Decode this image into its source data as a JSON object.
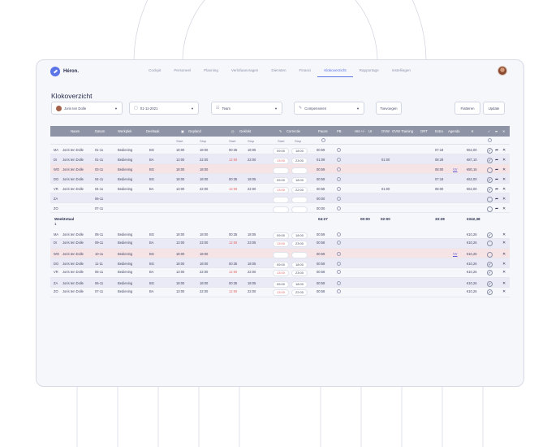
{
  "nav": {
    "brand": "Héron.",
    "items": [
      "Cockpit",
      "Personeel",
      "Planning",
      "Verlofaanvragen",
      "Diensten",
      "Financi",
      "Klokoverzicht",
      "Rapportage",
      "Instellingen"
    ],
    "active_index": 6
  },
  "page": {
    "title": "Klokoverzicht"
  },
  "filters": {
    "employee": "Joris ten Dolle",
    "date": "01-11-2021",
    "team": "Team",
    "completed": "Compenseren"
  },
  "buttons": {
    "add": "Toevoegen",
    "approve": "Fiatteren",
    "update": "Update"
  },
  "columns": {
    "name": "Naam",
    "date": "Datum",
    "workplace": "Werkplek",
    "department": "Deeltaak",
    "planned": "Gepland",
    "clocked": "Geklokt",
    "corrected": "Correctie",
    "break": "Pauze",
    "pb": "PB",
    "hrs": "Hrs +/-",
    "pct": "Ur",
    "ovw": "OVW",
    "ovw_training": "OVW Training",
    "ort": "ORT",
    "extra": "Extra",
    "agenda": "Agenda",
    "euro": "€"
  },
  "subcolumns": {
    "start": "Start",
    "stop": "Stop"
  },
  "week1_rows": [
    {
      "day": "MA",
      "name": "Joris ten Dolle",
      "date": "01-11",
      "workplace": "Bediening",
      "dept": "BG",
      "plan_start": "18:00",
      "plan_stop": "18:00",
      "clk_start": "00:35",
      "clk_stop": "18:05",
      "cor_start": "09:00",
      "cor_stop": "18:00",
      "pause": "00:59",
      "ovw": "",
      "extra": "07:18",
      "agenda": "",
      "euro": "€62,00"
    },
    {
      "day": "DI",
      "name": "Joris ten Dolle",
      "date": "01-11",
      "workplace": "Bediening",
      "dept": "BA",
      "plan_start": "13:00",
      "plan_stop": "22:00",
      "clk_start": "12:59",
      "clk_stop": "22:00",
      "cor_start": "13:00",
      "cor_stop": "23:00",
      "pause": "01:09",
      "ovw": "01:00",
      "extra": "08:28",
      "agenda": "",
      "euro": "€87,10"
    },
    {
      "day": "WO",
      "name": "Joris ten Dolle",
      "date": "03-11",
      "workplace": "Bediening",
      "dept": "BG",
      "plan_start": "18:00",
      "plan_stop": "18:00",
      "clk_start": "",
      "clk_stop": "",
      "cor_start": "",
      "cor_stop": "",
      "pause": "00:59",
      "ovw": "",
      "extra": "08:00",
      "agenda": "VV",
      "euro": "€80,16"
    },
    {
      "day": "DO",
      "name": "Joris ten Dolle",
      "date": "04-11",
      "workplace": "Bediening",
      "dept": "BG",
      "plan_start": "18:00",
      "plan_stop": "18:00",
      "clk_start": "00:35",
      "clk_stop": "18:05",
      "cor_start": "09:00",
      "cor_stop": "18:00",
      "pause": "00:59",
      "ovw": "",
      "extra": "07:18",
      "agenda": "",
      "euro": "€62,00"
    },
    {
      "day": "VR",
      "name": "Joris ten Dolle",
      "date": "04-11",
      "workplace": "Bediening",
      "dept": "BA",
      "plan_start": "13:00",
      "plan_stop": "22:00",
      "clk_start": "12:59",
      "clk_stop": "22:00",
      "cor_start": "13:00",
      "cor_stop": "22:00",
      "pause": "00:58",
      "ovw": "01:00",
      "extra": "08:00",
      "agenda": "",
      "euro": "€62,00"
    },
    {
      "day": "ZA",
      "name": "",
      "date": "06-11",
      "workplace": "",
      "dept": "",
      "plan_start": "",
      "plan_stop": "",
      "clk_start": "",
      "clk_stop": "",
      "cor_start": "",
      "cor_stop": "",
      "pause": "00:00",
      "ovw": "",
      "extra": "",
      "agenda": "",
      "euro": ""
    },
    {
      "day": "ZO",
      "name": "",
      "date": "07-11",
      "workplace": "",
      "dept": "",
      "plan_start": "",
      "plan_stop": "",
      "clk_start": "",
      "clk_stop": "",
      "cor_start": "",
      "cor_stop": "",
      "pause": "00:00",
      "ovw": "",
      "extra": "",
      "agenda": "",
      "euro": ""
    }
  ],
  "week_total": {
    "label": "Weektotaal",
    "sub": "1",
    "pause": "04:27",
    "hrs": "00:00",
    "ovw": "02:00",
    "extra": "33:28",
    "euro": "€342,38"
  },
  "week2_rows": [
    {
      "day": "MA",
      "name": "Joris ten Dolle",
      "date": "08-11",
      "workplace": "Bediening",
      "dept": "BG",
      "plan_start": "18:00",
      "plan_stop": "18:00",
      "clk_start": "00:35",
      "clk_stop": "18:05",
      "cor_start": "09:00",
      "cor_stop": "18:00",
      "pause": "00:59",
      "agenda": "",
      "euro": "€10,26"
    },
    {
      "day": "DI",
      "name": "Joris ten Dolle",
      "date": "09-11",
      "workplace": "Bediening",
      "dept": "BA",
      "plan_start": "13:00",
      "plan_stop": "23:00",
      "clk_start": "12:59",
      "clk_stop": "23:05",
      "cor_start": "13:00",
      "cor_stop": "23:00",
      "pause": "00:58",
      "agenda": "",
      "euro": "€10,26"
    },
    {
      "day": "WO",
      "name": "Joris ten Dolle",
      "date": "10-11",
      "workplace": "Bediening",
      "dept": "BG",
      "plan_start": "18:00",
      "plan_stop": "18:00",
      "clk_start": "",
      "clk_stop": "",
      "cor_start": "",
      "cor_stop": "",
      "pause": "00:59",
      "agenda": "VV",
      "euro": "€10,26"
    },
    {
      "day": "DO",
      "name": "Joris ten Dolle",
      "date": "11-11",
      "workplace": "Bediening",
      "dept": "BG",
      "plan_start": "18:00",
      "plan_stop": "18:00",
      "clk_start": "00:35",
      "clk_stop": "18:05",
      "cor_start": "09:00",
      "cor_stop": "18:00",
      "pause": "00:59",
      "agenda": "",
      "euro": "€10,26"
    },
    {
      "day": "VR",
      "name": "Joris ten Dolle",
      "date": "05-11",
      "workplace": "Bediening",
      "dept": "BA",
      "plan_start": "13:00",
      "plan_stop": "22:00",
      "clk_start": "12:59",
      "clk_stop": "22:00",
      "cor_start": "13:00",
      "cor_stop": "23:00",
      "pause": "00:58",
      "agenda": "",
      "euro": "€10,26"
    },
    {
      "day": "ZA",
      "name": "Joris ten Dolle",
      "date": "06-11",
      "workplace": "Bediening",
      "dept": "BG",
      "plan_start": "18:00",
      "plan_stop": "18:00",
      "clk_start": "00:35",
      "clk_stop": "18:05",
      "cor_start": "09:00",
      "cor_stop": "18:00",
      "pause": "00:59",
      "agenda": "",
      "euro": "€10,26"
    },
    {
      "day": "ZO",
      "name": "Joris ten Dolle",
      "date": "07-11",
      "workplace": "Bediening",
      "dept": "BA",
      "plan_start": "13:00",
      "plan_stop": "22:00",
      "clk_start": "12:59",
      "clk_stop": "22:00",
      "cor_start": "13:00",
      "cor_stop": "22:00",
      "pause": "00:58",
      "agenda": "",
      "euro": "€10,26"
    }
  ]
}
